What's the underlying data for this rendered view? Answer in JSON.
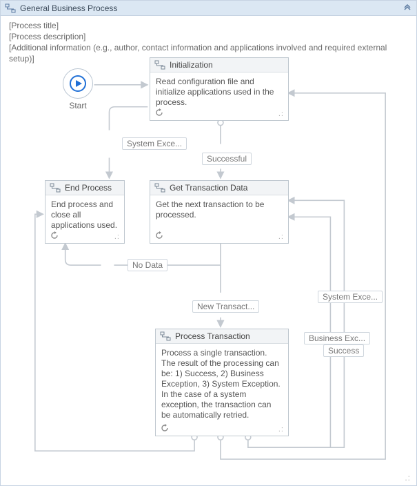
{
  "header": {
    "title": "General Business Process"
  },
  "placeholders": {
    "title": "[Process title]",
    "description": "[Process description]",
    "additional": "[Additional information (e.g., author, contact information and applications involved and required external setup)]"
  },
  "start": {
    "label": "Start"
  },
  "nodes": {
    "initialization": {
      "title": "Initialization",
      "body": "Read configuration file and initialize applications used in the process."
    },
    "end_process": {
      "title": "End Process",
      "body": "End process and close all applications used."
    },
    "get_transaction": {
      "title": "Get Transaction Data",
      "body": "Get the next transaction to be processed."
    },
    "process_transaction": {
      "title": "Process Transaction",
      "body": "Process a single transaction.\nThe result of the processing can be: 1) Success, 2) Business Exception, 3) System Exception.\nIn the case of a system exception, the transaction can be automatically retried."
    }
  },
  "edges": {
    "system_exc1": "System Exce...",
    "successful": "Successful",
    "no_data": "No Data",
    "new_transaction": "New Transact...",
    "system_exc2": "System Exce...",
    "business_exc": "Business Exc...",
    "success": "Success"
  }
}
